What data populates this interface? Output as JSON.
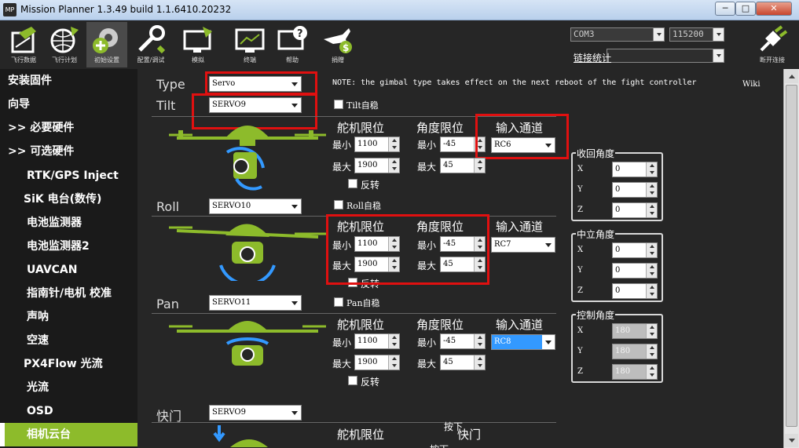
{
  "window": {
    "app_icon": "MP",
    "title": "Mission Planner 1.3.49 build 1.1.6410.20232",
    "min_glyph": "─",
    "max_glyph": "□",
    "close_glyph": "✕"
  },
  "toolbar": {
    "items": [
      {
        "label": "飞行数据",
        "icon": "flight-data-icon"
      },
      {
        "label": "飞行计划",
        "icon": "flight-plan-icon"
      },
      {
        "label": "初始设置",
        "icon": "initial-setup-icon"
      },
      {
        "label": "配置/调试",
        "icon": "config-tuning-icon"
      },
      {
        "label": "模拟",
        "icon": "simulation-icon"
      },
      {
        "label": "终端",
        "icon": "terminal-icon"
      },
      {
        "label": "帮助",
        "icon": "help-icon"
      },
      {
        "label": "捐赠",
        "icon": "donate-icon"
      }
    ],
    "com_port": "COM3",
    "baud_rate": "115200",
    "link_stats_label": "链接统计",
    "connect_label": "断开连接",
    "connect_icon": "connect-plug-icon"
  },
  "sidebar": {
    "items": [
      {
        "label": "安装固件",
        "level": 0
      },
      {
        "label": "向导",
        "level": 0
      },
      {
        "label": ">> 必要硬件",
        "level": 0
      },
      {
        "label": ">> 可选硬件",
        "level": 0
      },
      {
        "label": "RTK/GPS Inject",
        "level": 1
      },
      {
        "label": "SiK 电台(数传)",
        "level": 1
      },
      {
        "label": "电池监测器",
        "level": 1
      },
      {
        "label": "电池监测器2",
        "level": 1
      },
      {
        "label": "UAVCAN",
        "level": 1
      },
      {
        "label": "指南针/电机 校准",
        "level": 1
      },
      {
        "label": "声呐",
        "level": 1
      },
      {
        "label": "空速",
        "level": 1
      },
      {
        "label": "PX4Flow 光流",
        "level": 1
      },
      {
        "label": "光流",
        "level": 1
      },
      {
        "label": "OSD",
        "level": 1
      },
      {
        "label": "相机云台",
        "level": 1,
        "active": true
      }
    ]
  },
  "gimbal": {
    "type_label": "Type",
    "type_value": "Servo",
    "note": "NOTE: the gimbal type takes effect on the next reboot of the fight controller",
    "wiki": "Wiki",
    "servo_limit_header": "舵机限位",
    "angle_limit_header": "角度限位",
    "input_channel_header": "输入通道",
    "min_label": "最小",
    "max_label": "最大",
    "reverse_label": "反转",
    "tilt": {
      "label": "Tilt",
      "servo": "SERVO9",
      "stabilize": "Tilt自稳",
      "servo_min": "1100",
      "servo_max": "1900",
      "angle_min": "-45",
      "angle_max": "45",
      "channel": "RC6"
    },
    "roll": {
      "label": "Roll",
      "servo": "SERVO10",
      "stabilize": "Roll自稳",
      "servo_min": "1100",
      "servo_max": "1900",
      "angle_min": "-45",
      "angle_max": "45",
      "channel": "RC7"
    },
    "pan": {
      "label": "Pan",
      "servo": "SERVO11",
      "stabilize": "Pan自稳",
      "servo_min": "1100",
      "servo_max": "1900",
      "angle_min": "-45",
      "angle_max": "45",
      "channel": "RC8"
    },
    "shutter": {
      "label": "快门",
      "servo": "SERVO9",
      "pushed_label": "按下",
      "shutter_header": "快门",
      "partial_text": "按下"
    },
    "retract_angle": {
      "title": "收回角度",
      "x": "0",
      "y": "0",
      "z": "0"
    },
    "neutral_angle": {
      "title": "中立角度",
      "x": "0",
      "y": "0",
      "z": "0"
    },
    "control_angle": {
      "title": "控制角度",
      "x": "180",
      "y": "180",
      "z": "180"
    },
    "axis_x": "X",
    "axis_y": "Y",
    "axis_z": "Z"
  },
  "colors": {
    "accent_green": "#8dbb2b",
    "highlight_red": "#e01010",
    "selected_blue": "#3399ff"
  }
}
